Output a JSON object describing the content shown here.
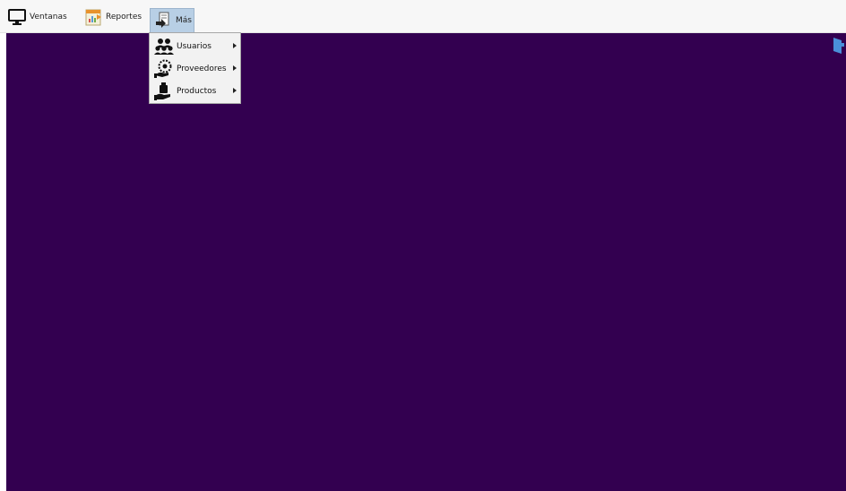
{
  "menubar": {
    "items": [
      {
        "label": "Ventanas",
        "icon": "monitor-icon"
      },
      {
        "label": "Reportes",
        "icon": "report-chart-icon"
      },
      {
        "label": "Más",
        "icon": "document-arrow-icon"
      }
    ]
  },
  "dropdown": {
    "items": [
      {
        "label": "Usuarios",
        "icon": "users-group-icon"
      },
      {
        "label": "Proveedores",
        "icon": "supplier-icon"
      },
      {
        "label": "Productos",
        "icon": "product-hand-icon"
      }
    ]
  },
  "colors": {
    "desktop": "#330050",
    "menubar": "#f7f7f7",
    "active_menu": "#b8cfe5",
    "corner_icon": "#4a90d9"
  }
}
